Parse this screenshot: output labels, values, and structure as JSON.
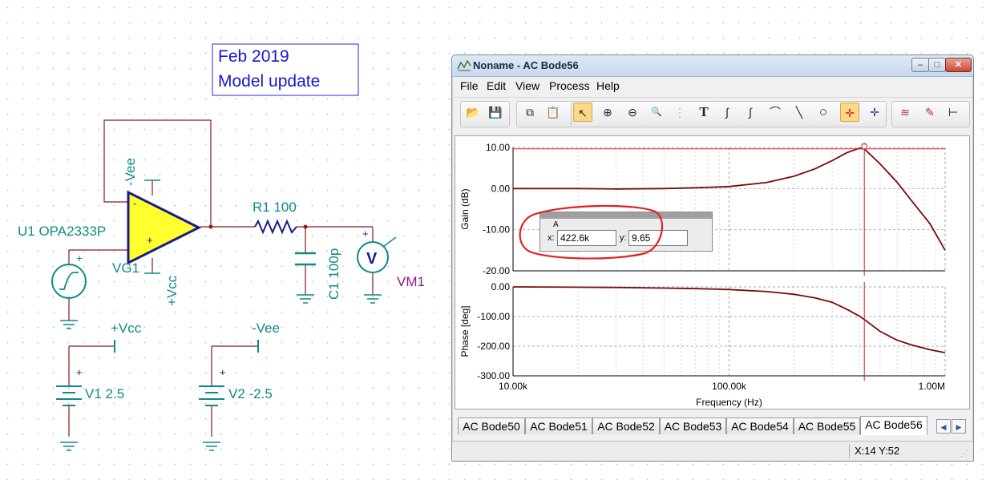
{
  "schematic": {
    "note_line1": "Feb 2019",
    "note_line2": "Model update",
    "opamp_label": "U1 OPA2333P",
    "opamp_minus_supply": "-Vee",
    "opamp_plus_supply": "+Vcc",
    "opamp_minus_sign": "-",
    "opamp_plus_sign": "+",
    "source_label": "VG1",
    "r1_label": "R1 100",
    "c1_label": "C1 100p",
    "vm_label": "VM1",
    "vm_symbol": "V",
    "v1_terminal": "+Vcc",
    "v2_terminal": "-Vee",
    "v1_label": "V1 2.5",
    "v2_label": "V2 -2.5",
    "plus_mark": "+"
  },
  "window": {
    "title": "Noname - AC Bode56",
    "min": "–",
    "max": "□",
    "close": "✕",
    "menus": [
      "File",
      "Edit",
      "View",
      "Process",
      "Help"
    ]
  },
  "toolbar": {
    "icons": [
      "open-folder-icon",
      "save-icon",
      "copy-icon",
      "paste-icon",
      "pointer-icon",
      "zoom-in-icon",
      "zoom-out-icon",
      "zoom-100-icon",
      "grid-icon",
      "text-icon",
      "curve-icon-a",
      "curve-icon-b",
      "curve-icon-c",
      "line-icon",
      "circle-icon",
      "cursor-a-icon",
      "cursor-b-icon",
      "add-trace-icon",
      "marker-icon",
      "corner-icon"
    ],
    "glyphs": {
      "open": "📂",
      "save": "💾",
      "copy": "⧉",
      "paste": "📋",
      "pointer": "↖",
      "zoomin": "⊕",
      "zoomout": "⊖",
      "zoom100": "🔍",
      "grid": "⋮",
      "text": "T",
      "curve1": "∫",
      "curve2": "∫",
      "curve3": "⌒",
      "line": "╲",
      "circle": "○",
      "cursora": "✛",
      "cursorb": "✛",
      "addtrace": "≋",
      "marker": "✎",
      "corner": "⊢"
    }
  },
  "chart_data": [
    {
      "type": "line",
      "title": "",
      "xlabel": "",
      "ylabel": "Gain (dB)",
      "xscale": "log",
      "xlim": [
        10000,
        1000000
      ],
      "ylim": [
        -20,
        10
      ],
      "y_ticks": [
        "10.00",
        "0.00",
        "-10.00",
        "-20.00"
      ],
      "grid": true,
      "series": [
        {
          "x": [
            10000,
            20000,
            30000,
            50000,
            70000,
            100000,
            150000,
            200000,
            250000,
            300000,
            350000,
            400000,
            422600,
            500000,
            600000,
            700000,
            850000,
            1000000
          ],
          "y": [
            0,
            0,
            -0.1,
            0,
            0.2,
            0.5,
            1.5,
            3,
            4.8,
            6.8,
            8.7,
            9.8,
            9.65,
            6,
            1.5,
            -3,
            -8.5,
            -15
          ]
        }
      ],
      "cursor": {
        "x": 422600,
        "y": 9.65
      }
    },
    {
      "type": "line",
      "title": "",
      "xlabel": "Frequency (Hz)",
      "ylabel": "Phase [deg]",
      "xscale": "log",
      "xlim": [
        10000,
        1000000
      ],
      "ylim": [
        -300,
        0
      ],
      "x_ticks": [
        "10.00k",
        "100.00k",
        "1.00M"
      ],
      "y_ticks": [
        "0.00",
        "-100.00",
        "-200.00",
        "-300.00"
      ],
      "grid": true,
      "series": [
        {
          "x": [
            10000,
            20000,
            30000,
            50000,
            70000,
            100000,
            150000,
            200000,
            250000,
            300000,
            350000,
            400000,
            422600,
            500000,
            600000,
            700000,
            850000,
            1000000
          ],
          "y": [
            0,
            -1,
            -2,
            -4,
            -6,
            -9,
            -16,
            -25,
            -37,
            -52,
            -75,
            -98,
            -110,
            -150,
            -180,
            -196,
            -212,
            -222
          ]
        }
      ]
    }
  ],
  "cursor_box": {
    "label": "A",
    "x_label": "x:",
    "x_value": "422.6k",
    "y_label": "y:",
    "y_value": "9.65"
  },
  "tabs": [
    "AC Bode50",
    "AC Bode51",
    "AC Bode52",
    "AC Bode53",
    "AC Bode54",
    "AC Bode55",
    "AC Bode56"
  ],
  "status": {
    "text": "X:14  Y:52"
  },
  "colors": {
    "trace": "#7a0a0a",
    "wire": "#9b2020",
    "cursor": "#d02020",
    "annot": "#e02020",
    "opamp_fill": "#ffff2e",
    "schematic_text": "#0e8a84",
    "blue": "#1a1a8c"
  }
}
